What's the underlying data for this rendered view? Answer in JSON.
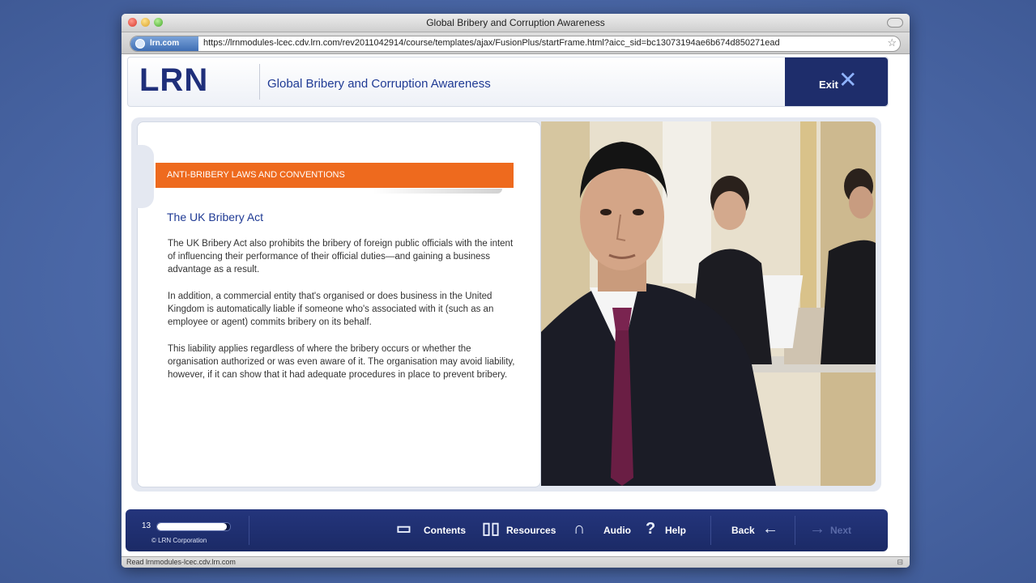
{
  "browser": {
    "window_title": "Global Bribery and Corruption Awareness",
    "site_badge": "lrn.com",
    "url": "https://lrnmodules-lcec.cdv.lrn.com/rev2011042914/course/templates/ajax/FusionPlus/startFrame.html?aicc_sid=bc13073194ae6b674d850271ead",
    "status_text": "Read lrnmodules-lcec.cdv.lrn.com"
  },
  "header": {
    "logo": "LRN",
    "course_title": "Global Bribery and Corruption Awareness",
    "exit_label": "Exit"
  },
  "lesson": {
    "section_banner": "ANTI-BRIBERY LAWS AND CONVENTIONS",
    "heading": "The UK Bribery Act",
    "paragraphs": [
      "The UK Bribery Act also prohibits the bribery of foreign public officials with the intent of influencing their performance of their official duties—and gaining a business advantage as a result.",
      "In addition, a commercial entity that's organised or does business in the United Kingdom is automatically liable if someone who's associated with it (such as an employee or agent) commits bribery on its behalf.",
      "This liability applies regardless of where the bribery occurs or whether the organisation authorized or was even aware of it. The organisation may avoid liability, however, if it can show that it had adequate procedures in place to prevent bribery."
    ]
  },
  "footer": {
    "page_number": "13",
    "progress_fraction": 0.95,
    "copyright": "© LRN Corporation",
    "contents_label": "Contents",
    "resources_label": "Resources",
    "audio_label": "Audio",
    "help_label": "Help",
    "back_label": "Back",
    "next_label": "Next"
  },
  "icons": {
    "contents": "contents-icon",
    "resources": "book-icon",
    "audio": "headphones-icon",
    "help": "question-icon",
    "back": "arrow-left-icon",
    "next": "arrow-right-icon",
    "exit": "close-x-icon"
  },
  "colors": {
    "brand_navy": "#1e2d6b",
    "accent_orange": "#ee6a1e",
    "heading_blue": "#1f3a94"
  }
}
